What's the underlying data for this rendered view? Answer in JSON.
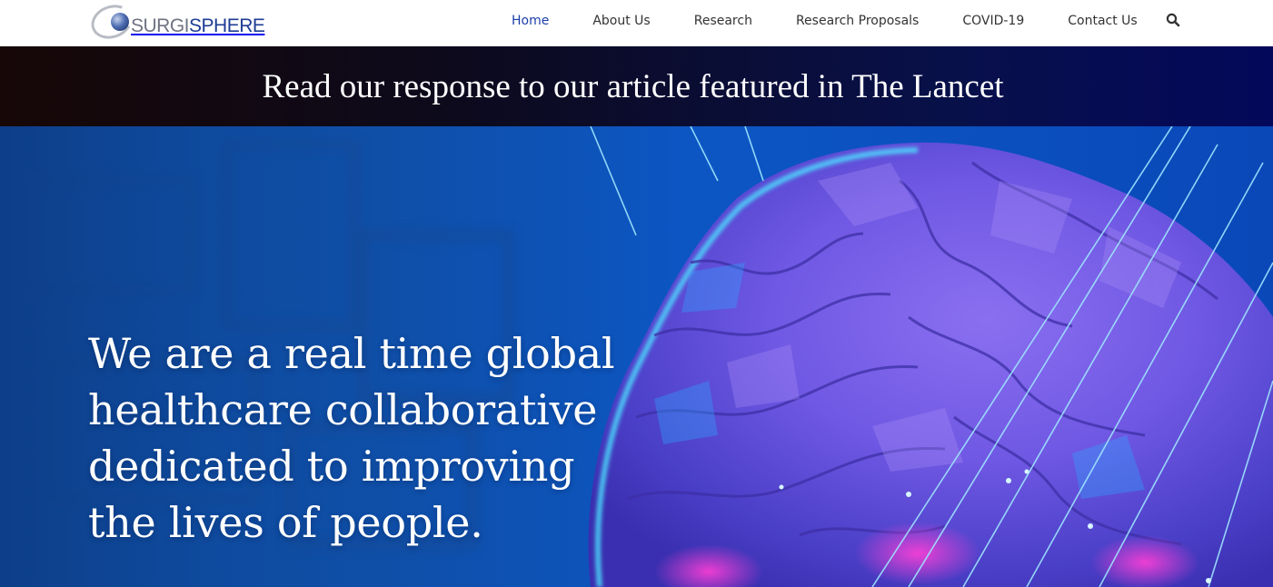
{
  "brand": {
    "name_part1": "SURGI",
    "name_part2": "SPHERE",
    "colors": {
      "grey": "#6f7382",
      "blue": "#1d3d95"
    }
  },
  "nav": {
    "items": [
      {
        "label": "Home",
        "active": true
      },
      {
        "label": "About Us",
        "active": false
      },
      {
        "label": "Research",
        "active": false
      },
      {
        "label": "Research Proposals",
        "active": false
      },
      {
        "label": "COVID-19",
        "active": false
      },
      {
        "label": "Contact Us",
        "active": false
      }
    ],
    "search_icon": "search-icon",
    "active_color": "#1b3faa"
  },
  "banner": {
    "text": "Read our response to our article featured in The Lancet"
  },
  "hero": {
    "heading_lines": [
      "We are a real time global",
      "healthcare collaborative",
      "dedicated to improving",
      "the lives of people."
    ],
    "image": "brain-illustration",
    "colors": {
      "background": "#0c56c4",
      "brain": "#7a5ee8",
      "glow": "#4de4ff"
    }
  }
}
